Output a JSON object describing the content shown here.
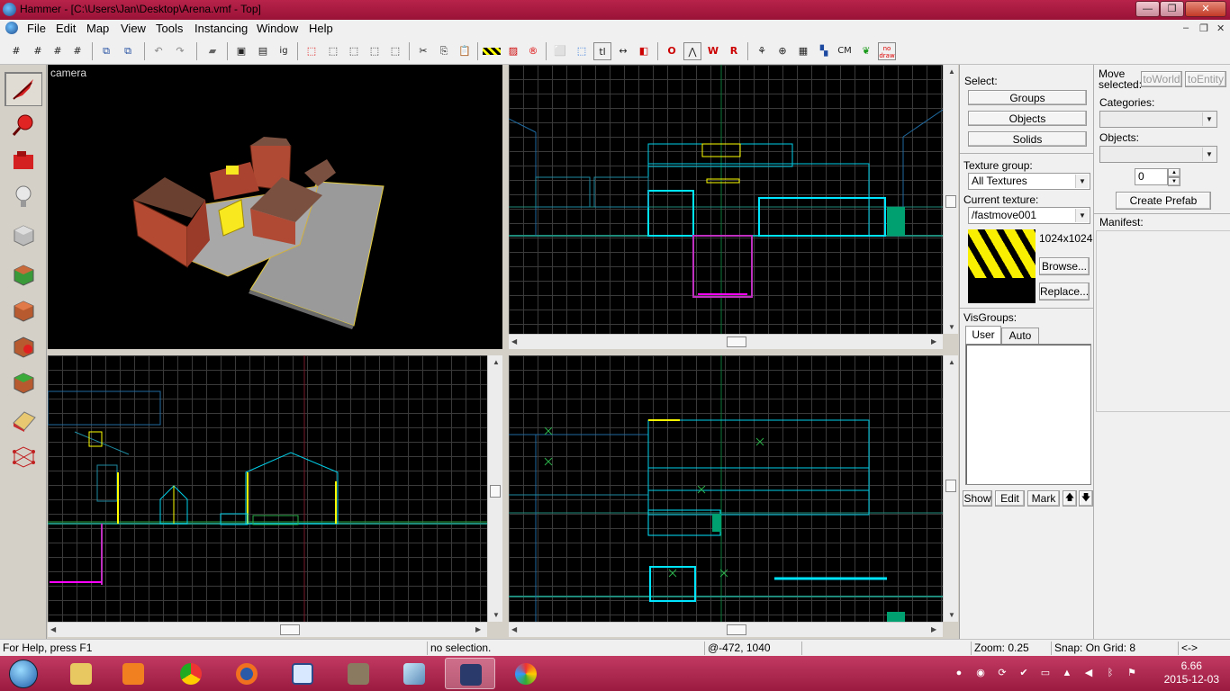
{
  "window": {
    "title": "Hammer - [C:\\Users\\Jan\\Desktop\\Arena.vmf - Top]",
    "min_label": "—",
    "max_label": "❐",
    "close_label": "✕"
  },
  "menubar": {
    "items": [
      "File",
      "Edit",
      "Map",
      "View",
      "Tools",
      "Instancing",
      "Window",
      "Help"
    ],
    "mdi_min": "–",
    "mdi_restore": "❐",
    "mdi_close": "✕"
  },
  "toolbar": {
    "cm_label": "CM",
    "nodraw_label": "no draw"
  },
  "viewports": {
    "camera_label": "camera"
  },
  "right_panel": {
    "select_label": "Select:",
    "groups_button": "Groups",
    "objects_button": "Objects",
    "solids_button": "Solids",
    "move_selected_label": "Move selected:",
    "to_world_button": "toWorld",
    "to_entity_button": "toEntity",
    "categories_label": "Categories:",
    "objects_label": "Objects:",
    "count_value": "0",
    "create_prefab_button": "Create Prefab",
    "manifest_label": "Manifest:",
    "texture_group_label": "Texture group:",
    "texture_group_value": "All Textures",
    "current_texture_label": "Current texture:",
    "current_texture_value": "/fastmove001",
    "texture_size": "1024x1024",
    "browse_button": "Browse...",
    "replace_button": "Replace...",
    "visgroups_label": "VisGroups:",
    "tab_user": "User",
    "tab_auto": "Auto",
    "show_button": "Show",
    "edit_button": "Edit",
    "mark_button": "Mark",
    "up_button": "🡅",
    "down_button": "🡇"
  },
  "statusbar": {
    "help": "For Help, press F1",
    "selection": "no selection.",
    "coords": "@-472, 1040",
    "zoom": "Zoom: 0.25",
    "snap": "Snap: On Grid: 8",
    "extra": "<->"
  },
  "taskbar": {
    "time": "6.66",
    "date": "2015-12-03"
  },
  "colors": {
    "titlebar": "#b8234a",
    "taskbar": "#c13a62",
    "grid_line": "#3a3a3a",
    "brush_cyan": "#00e5ff",
    "selection_yellow": "#ffff00",
    "entity_magenta": "#ff00ff"
  }
}
